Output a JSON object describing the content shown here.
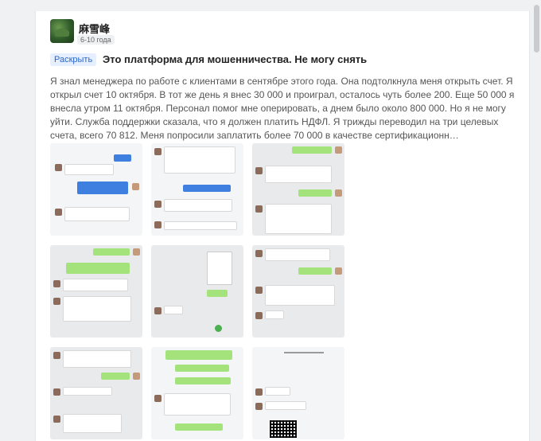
{
  "post": {
    "user_name": "麻雪峰",
    "date": "6-10 года",
    "expand_label": "Раскрыть",
    "title": "Это платформа для мошенничества. Не могу снять",
    "body": "Я знал менеджера по работе с клиентами в сентябре этого года. Она подтолкнула меня открыть счет. Я открыл счет 10 октября. В тот же день я внес 30 000 и проиграл, осталось чуть более 200. Еще 50 000 я внесла утром 11 октября. Персонал помог мне оперировать, а днем было около 800 000. Но я не могу уйти. Служба поддержки сказала, что я должен платить НДФЛ. Я трижды переводил на три целевых счета, всего 70 812. Меня попросили заплатить более 70 000 в качестве сертификационн…"
  },
  "thumbnails": [
    {
      "id": "chat-screenshot-1",
      "style": "white"
    },
    {
      "id": "chat-screenshot-2",
      "style": "white"
    },
    {
      "id": "chat-screenshot-3",
      "style": "gray"
    },
    {
      "id": "chat-screenshot-4",
      "style": "gray"
    },
    {
      "id": "app-screenshot-5",
      "style": "gray"
    },
    {
      "id": "chat-screenshot-6",
      "style": "gray"
    },
    {
      "id": "chat-screenshot-7",
      "style": "gray"
    },
    {
      "id": "chat-screenshot-8",
      "style": "white"
    },
    {
      "id": "qr-screenshot-9",
      "style": "white"
    }
  ]
}
